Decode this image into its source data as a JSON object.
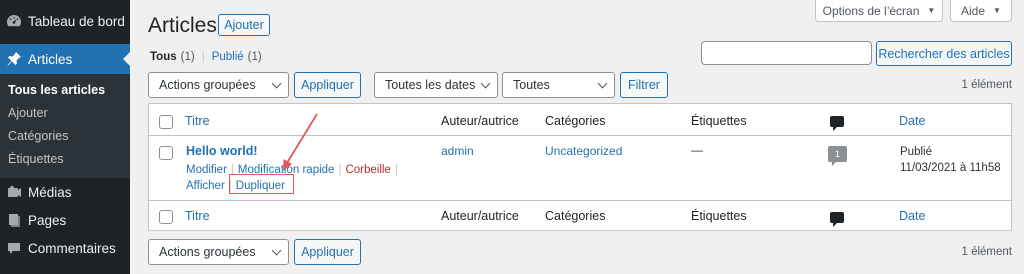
{
  "sidebar": {
    "dashboard": {
      "label": "Tableau de bord",
      "icon": "dashboard-icon"
    },
    "posts": {
      "label": "Articles",
      "icon": "pin-icon"
    },
    "submenu": [
      "Tous les articles",
      "Ajouter",
      "Catégories",
      "Étiquettes"
    ],
    "media": {
      "label": "Médias",
      "icon": "media-icon"
    },
    "pages": {
      "label": "Pages",
      "icon": "page-icon"
    },
    "comments": {
      "label": "Commentaires",
      "icon": "comment-icon"
    }
  },
  "header": {
    "title": "Articles",
    "add_button": "Ajouter",
    "screen_options": "Options de l’écran",
    "help": "Aide"
  },
  "views": {
    "all_label": "Tous",
    "all_count": "(1)",
    "separator": "|",
    "published_label": "Publié",
    "published_count": "(1)"
  },
  "search": {
    "value": "",
    "button": "Rechercher des articles"
  },
  "filters": {
    "bulk_actions": "Actions groupées",
    "apply": "Appliquer",
    "dates": "Toutes les dates",
    "categories": "Toutes",
    "filter": "Filtrer"
  },
  "item_count": "1 élément",
  "table": {
    "columns": {
      "title": "Titre",
      "author": "Auteur/autrice",
      "categories": "Catégories",
      "tags": "Étiquettes",
      "comments_icon": "comment-icon",
      "date": "Date"
    },
    "rows": [
      {
        "title": "Hello world!",
        "actions": {
          "edit": "Modifier",
          "quick_edit": "Modification rapide",
          "trash": "Corbeille",
          "view": "Afficher",
          "duplicate": "Dupliquer"
        },
        "author": "admin",
        "category": "Uncategorized",
        "tags": "—",
        "comments": "1",
        "date_status": "Publié",
        "date_value": "11/03/2021 à 11h58"
      }
    ]
  },
  "colors": {
    "accent": "#2271b1",
    "sidebar": "#1d2327",
    "danger": "#b32d2e",
    "annotation": "#e05858"
  }
}
